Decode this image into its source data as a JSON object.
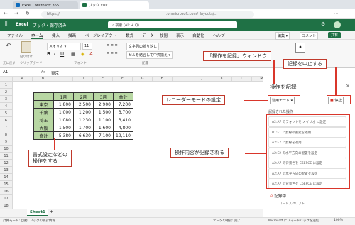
{
  "browser": {
    "tab1": "Excel | Microsoft 365",
    "tab2": "ブック.xlsx",
    "url": "https://",
    "url_tail": ".onmicrosoft.com/_layouts/..."
  },
  "excel": {
    "app": "Excel",
    "doc": "ブック・保存済み",
    "search_placeholder": "検索 (Alt + Q)"
  },
  "menu": {
    "items": [
      "ファイル",
      "ホーム",
      "挿入",
      "描画",
      "ページレイアウト",
      "数式",
      "データ",
      "校閲",
      "表示",
      "自動化",
      "ヘルプ"
    ],
    "active": "ホーム",
    "edit": "編集",
    "comment": "コメント",
    "share": "共有"
  },
  "ribbon": {
    "undo_label": "元に戻す",
    "clipboard": "クリップボード",
    "paste": "貼り付け",
    "font_name": "メイリオ",
    "font_size": "11",
    "font_group": "フォント",
    "wrap": "文字列の折り返し",
    "merge": "セルを結合して中央揃え",
    "align_group": "配置"
  },
  "formula_bar": {
    "cell_ref": "A1",
    "content": "東京"
  },
  "columns": [
    "A",
    "B",
    "C",
    "D",
    "E",
    "F",
    "G",
    "H",
    "I",
    "J",
    "K",
    "L",
    "M"
  ],
  "rows": [
    "1",
    "2",
    "3",
    "4",
    "5",
    "6",
    "7",
    "8",
    "9",
    "10",
    "11",
    "12",
    "13",
    "14",
    "15",
    "16",
    "17",
    "18"
  ],
  "table": {
    "headers": [
      "",
      "1月",
      "2月",
      "3月",
      "合計"
    ],
    "rows": [
      [
        "東京",
        "1,800",
        "2,500",
        "2,900",
        "7,200"
      ],
      [
        "千葉",
        "1,000",
        "1,200",
        "1,500",
        "3,700"
      ],
      [
        "埼玉",
        "1,080",
        "1,230",
        "1,100",
        "3,410"
      ],
      [
        "大阪",
        "1,500",
        "1,700",
        "1,600",
        "4,800"
      ],
      [
        "合計",
        "5,380",
        "6,630",
        "7,100",
        "19,110"
      ]
    ]
  },
  "sheet": {
    "tab": "Sheet1",
    "add": "+"
  },
  "status": {
    "left": "計算モード: 自動",
    "left2": "ブックの統計情報",
    "right1": "データの確認: 完了",
    "right2": "Microsoft にフィードバックを送信",
    "zoom": "100%"
  },
  "panel": {
    "title": "操作を記録",
    "mode": "適用モード",
    "stop": "停止",
    "recorded_title": "記録された操作",
    "items": [
      "A2:A7 のフォントを メイリオ に設定",
      "B1:E1 に罫線の書式を適用",
      "A2:E7 に罫線を適用",
      "A2:E2 の水平方向の配置を設定",
      "A2:A7 の背景色を C6EFCE に設定",
      "A2:A7 の水平方向の配置を設定",
      "A2:A7 の背景色を C6EFCE に設定"
    ],
    "recording": "記録中",
    "recording_sub": "コードスクリプト..."
  },
  "callouts": {
    "window": "「操作を記録」ウィンドウ",
    "stop": "記録を中止する",
    "mode": "レコーダーモードの設定",
    "format": "書式設定などの\n操作をする",
    "recorded": "操作内容が記録される"
  },
  "colors": {
    "excel_green": "#1f7145",
    "header_fill": "#b8d7a3",
    "callout_red": "#d9362b"
  }
}
